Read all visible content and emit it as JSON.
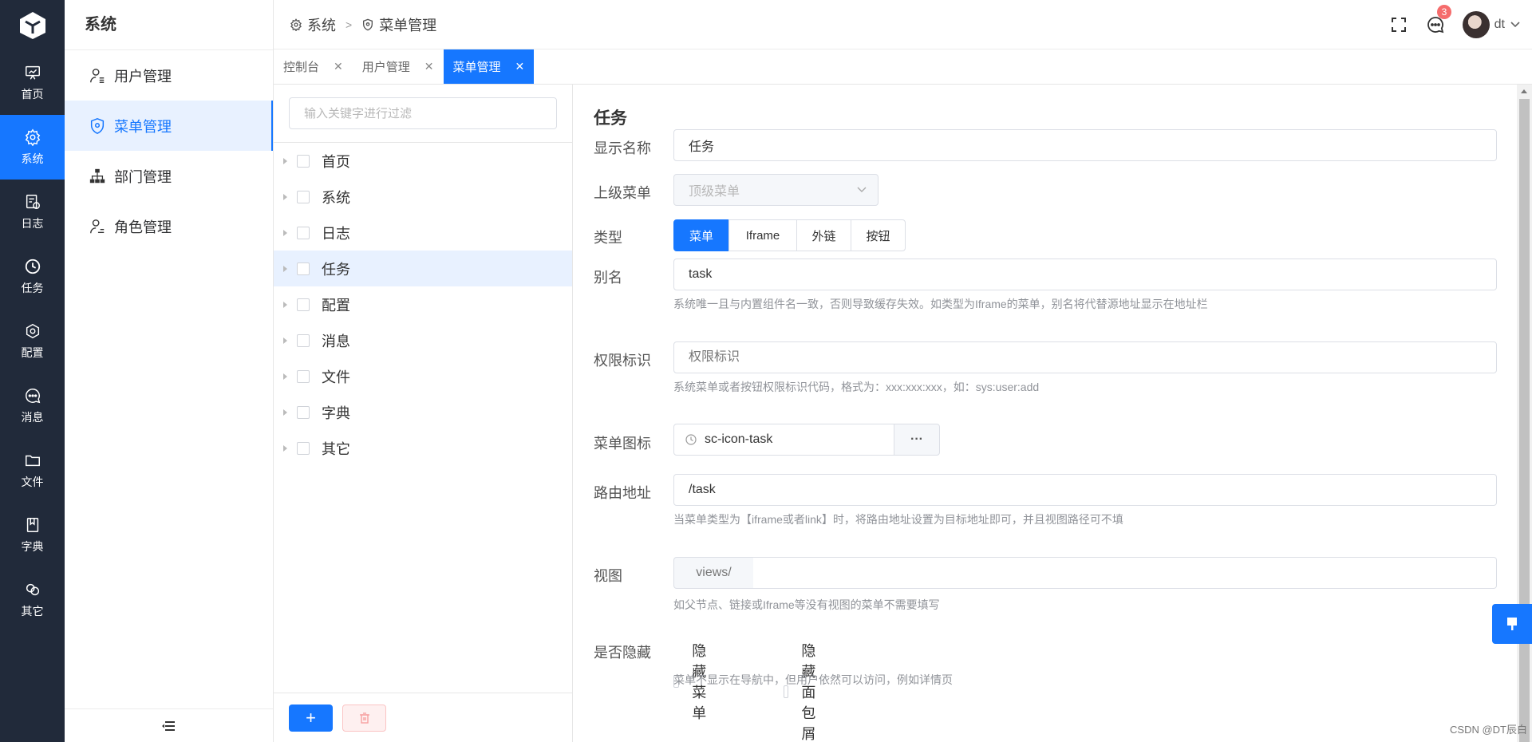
{
  "nav": {
    "items": [
      {
        "label": "首页",
        "icon": "presentation-icon"
      },
      {
        "label": "系统",
        "icon": "gear-icon"
      },
      {
        "label": "日志",
        "icon": "log-icon"
      },
      {
        "label": "任务",
        "icon": "clock-icon"
      },
      {
        "label": "配置",
        "icon": "settings-hex-icon"
      },
      {
        "label": "消息",
        "icon": "chat-icon"
      },
      {
        "label": "文件",
        "icon": "folder-icon"
      },
      {
        "label": "字典",
        "icon": "book-icon"
      },
      {
        "label": "其它",
        "icon": "link-icon"
      }
    ]
  },
  "submenu": {
    "title": "系统",
    "items": [
      {
        "label": "用户管理"
      },
      {
        "label": "菜单管理"
      },
      {
        "label": "部门管理"
      },
      {
        "label": "角色管理"
      }
    ]
  },
  "breadcrumb": {
    "root": "系统",
    "current": "菜单管理"
  },
  "header": {
    "badge_count": "3",
    "username": "dt"
  },
  "tabs": [
    {
      "label": "控制台"
    },
    {
      "label": "用户管理"
    },
    {
      "label": "菜单管理"
    }
  ],
  "tree": {
    "filter_placeholder": "输入关键字进行过滤",
    "nodes": [
      "首页",
      "系统",
      "日志",
      "任务",
      "配置",
      "消息",
      "文件",
      "字典",
      "其它"
    ]
  },
  "form": {
    "title": "任务",
    "display_name": {
      "label": "显示名称",
      "value": "任务"
    },
    "parent_menu": {
      "label": "上级菜单",
      "placeholder": "顶级菜单"
    },
    "type": {
      "label": "类型",
      "options": [
        "菜单",
        "Iframe",
        "外链",
        "按钮"
      ],
      "selected": "菜单"
    },
    "alias": {
      "label": "别名",
      "value": "task",
      "hint": "系统唯一且与内置组件名一致，否则导致缓存失效。如类型为Iframe的菜单，别名将代替源地址显示在地址栏"
    },
    "permission": {
      "label": "权限标识",
      "placeholder": "权限标识",
      "hint": "系统菜单或者按钮权限标识代码，格式为：xxx:xxx:xxx，如：sys:user:add"
    },
    "icon": {
      "label": "菜单图标",
      "value": "sc-icon-task",
      "more": "···"
    },
    "route": {
      "label": "路由地址",
      "value": "/task",
      "hint": "当菜单类型为【iframe或者link】时，将路由地址设置为目标地址即可，并且视图路径可不填"
    },
    "view": {
      "label": "视图",
      "prefix": "views/",
      "hint": "如父节点、链接或Iframe等没有视图的菜单不需要填写"
    },
    "hidden": {
      "label": "是否隐藏",
      "opt1": "隐藏菜单",
      "opt2": "隐藏面包屑",
      "hint": "菜单不显示在导航中，但用户依然可以访问，例如详情页"
    }
  },
  "watermark": "CSDN @DT辰白",
  "colors": {
    "primary": "#1677ff",
    "nav_bg": "#212a3a"
  }
}
